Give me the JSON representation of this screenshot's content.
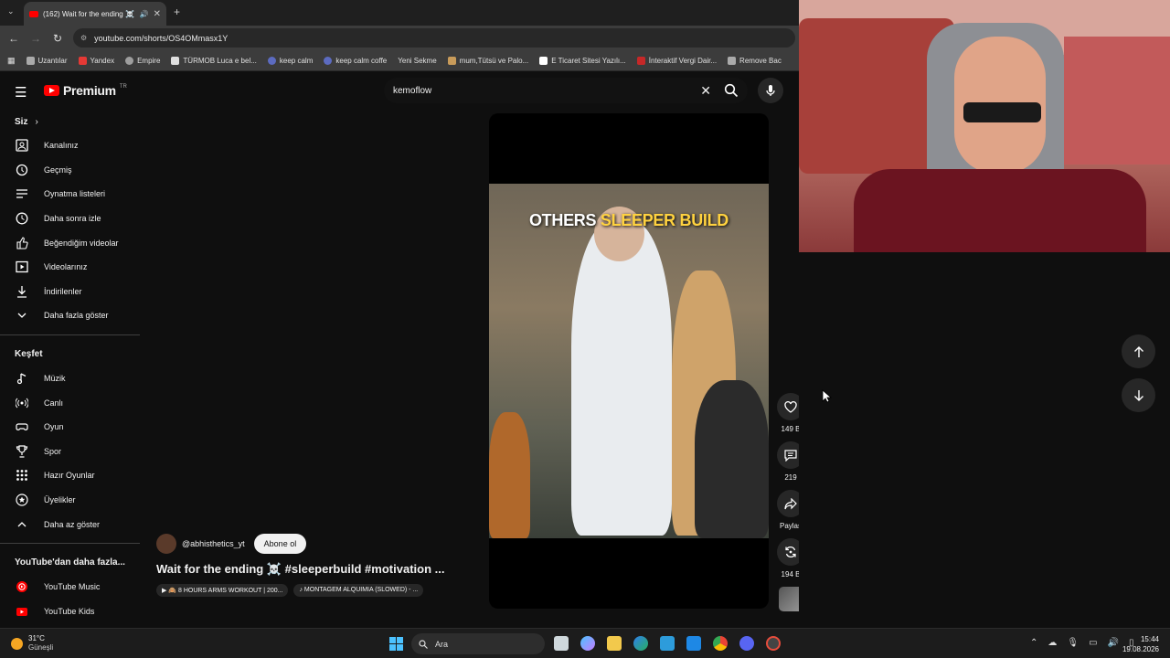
{
  "browser": {
    "tab_title": "(162) Wait for the ending ☠️",
    "url": "youtube.com/shorts/OS4OMmasx1Y",
    "bookmarks": [
      "Uzantılar",
      "Yandex",
      "Empire",
      "TÜRMOB Luca e bel...",
      "keep calm",
      "keep calm coffe",
      "Yeni Sekme",
      "mum,Tütsü ve Palo...",
      "E Ticaret Sitesi Yazılı...",
      "İnteraktif Vergi Dair...",
      "Remove Bac"
    ]
  },
  "youtube": {
    "logo_text": "Premium",
    "logo_sup": "TR",
    "search_query": "kemoflow"
  },
  "sidebar": {
    "you_heading": "Siz",
    "you_items": [
      "Kanalınız",
      "Geçmiş",
      "Oynatma listeleri",
      "Daha sonra izle",
      "Beğendiğim videolar",
      "Videolarınız",
      "İndirilenler",
      "Daha fazla göster"
    ],
    "explore_heading": "Keşfet",
    "explore_items": [
      "Müzik",
      "Canlı",
      "Oyun",
      "Spor",
      "Hazır Oyunlar",
      "Üyelikler",
      "Daha az göster"
    ],
    "more_heading": "YouTube'dan daha fazla...",
    "more_items": [
      "YouTube Music",
      "YouTube Kids"
    ]
  },
  "short": {
    "overlay_white": "OTHERS ",
    "overlay_yellow": "SLEEPER BUILD",
    "channel": "@abhisthetics_yt",
    "subscribe": "Abone ol",
    "title": "Wait for the ending ☠️ #sleeperbuild #motivation ...",
    "chip1": "▶ 🙈 8 HOURS ARMS WORKOUT | 200...",
    "chip2": "♪ MONTAGEM ALQUIMIA (SLOWED) - ...",
    "likes": "149 B",
    "comments": "219",
    "share": "Paylaş",
    "remix": "194 B"
  },
  "taskbar": {
    "temp": "31°C",
    "weather": "Güneşli",
    "search": "Ara",
    "time": "15:44",
    "date": "19.08.2026"
  },
  "colors": {
    "accent_red": "#ff0000",
    "highlight_yellow": "#ffd23f"
  }
}
